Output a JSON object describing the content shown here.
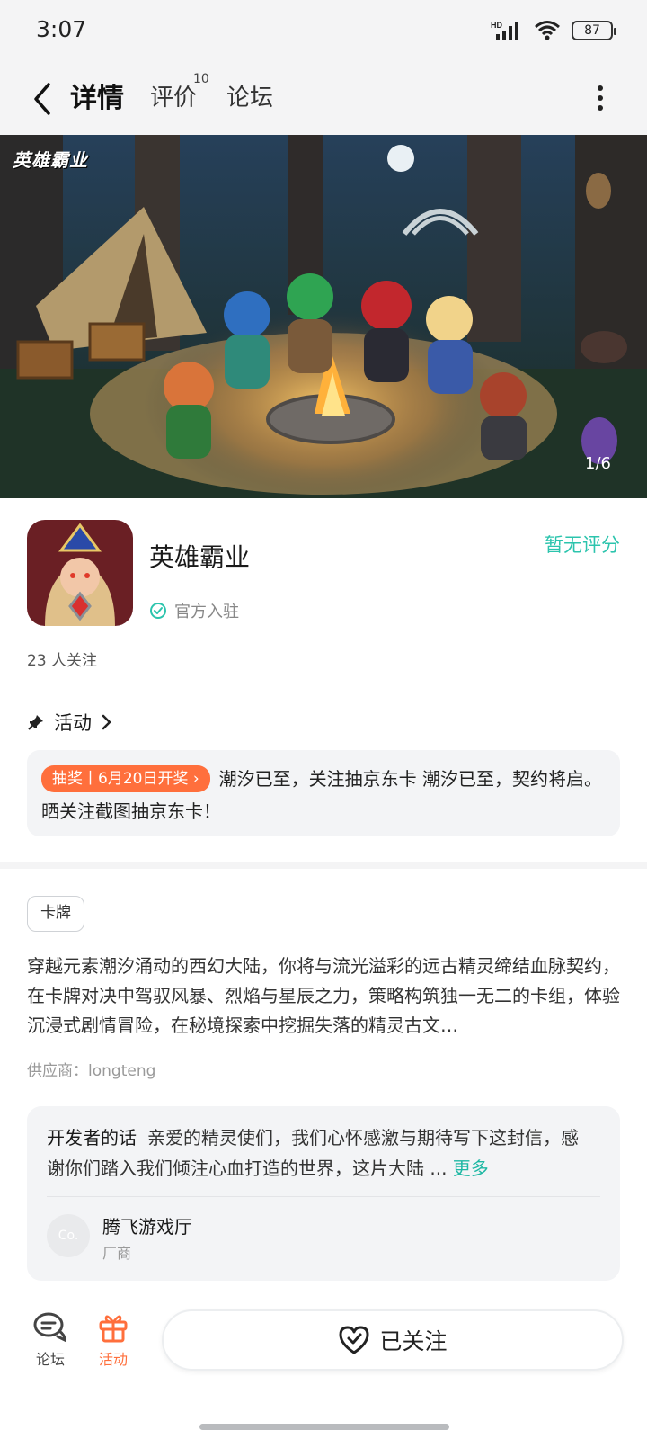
{
  "status_bar": {
    "time": "3:07",
    "battery": "87",
    "network": "HD"
  },
  "nav": {
    "tab_detail": "详情",
    "tab_review": "评价",
    "review_count": "10",
    "tab_forum": "论坛"
  },
  "banner": {
    "logo_text": "英雄霸业",
    "counter": "1/6"
  },
  "app": {
    "name": "英雄霸业",
    "official_label": "官方入驻",
    "rating_text": "暂无评分",
    "followers": "23 人关注"
  },
  "activity": {
    "heading": "活动",
    "tag": "抽奖丨6月20日开奖",
    "text": "潮汐已至，关注抽京东卡 潮汐已至，契约将启。晒关注截图抽京东卡！"
  },
  "genre_tag": "卡牌",
  "description": "穿越元素潮汐涌动的西幻大陆，你将与流光溢彩的远古精灵缔结血脉契约，在卡牌对决中驾驭风暴、烈焰与星辰之力，策略构筑独一无二的卡组，体验沉浸式剧情冒险，在秘境探索中挖掘失落的精灵古文…",
  "supplier": "供应商：longteng",
  "developer": {
    "label": "开发者的话",
    "text": "亲爱的精灵使们，我们心怀感激与期待写下这封信，感谢你们踏入我们倾注心血打造的世界，这片大陆 ...",
    "more": "更多",
    "avatar_text": "Co.",
    "name": "腾飞游戏厅",
    "role": "厂商"
  },
  "bottom_bar": {
    "forum": "论坛",
    "activity": "活动",
    "follow": "已关注"
  },
  "colors": {
    "accent": "#2cc4ad",
    "orange": "#ff6f3c"
  }
}
